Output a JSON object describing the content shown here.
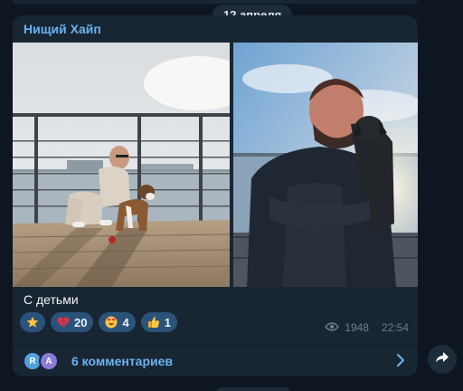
{
  "date_separator": "12 апреля",
  "post": {
    "channel_name": "Нищий Хайп",
    "caption": "С детьми",
    "reactions": [
      {
        "emoji_icon": "star-icon",
        "count": ""
      },
      {
        "emoji_icon": "broken-heart-icon",
        "count": "20"
      },
      {
        "emoji_icon": "heart-eyes-face-icon",
        "count": "4"
      },
      {
        "emoji_icon": "thumbs-up-icon",
        "count": "1"
      }
    ],
    "views": "1948",
    "time": "22:54",
    "comments": {
      "label": "6 комментариев",
      "avatars": [
        {
          "letter": "R",
          "color": "#4fa3e0"
        },
        {
          "letter": "A",
          "color": "#8b7bd8"
        }
      ]
    }
  },
  "colors": {
    "background": "#0e1621",
    "bubble": "#182533",
    "accent": "#6ab3f3",
    "reaction_pill": "#2b5278"
  }
}
